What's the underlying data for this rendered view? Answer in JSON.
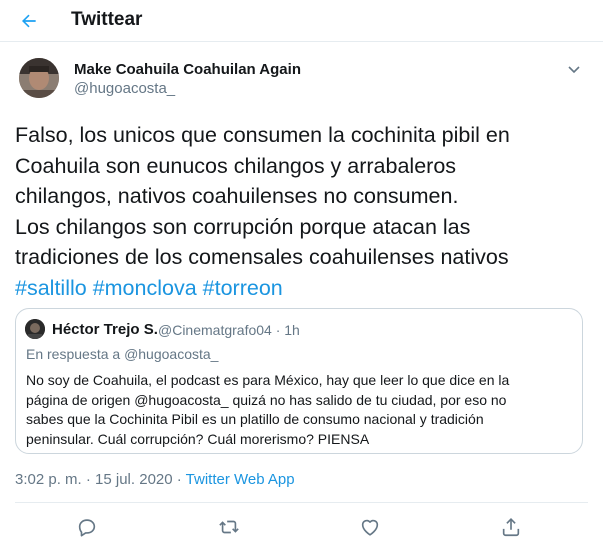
{
  "header": {
    "title": "Twittear",
    "back_icon": "arrow-left-icon"
  },
  "tweet": {
    "author_name": "Make Coahuila Coahuilan Again",
    "author_handle": "@hugoacosta_",
    "text_lines": [
      "Falso, los unicos que consumen la cochinita pibil en",
      "Coahuila son eunucos chilangos y arrabaleros",
      "chilangos, nativos coahuilenses no consumen.",
      "Los chilangos son corrupción porque atacan las",
      "tradiciones de los comensales coahuilenses nativos"
    ],
    "hashtags": [
      "#saltillo",
      "#monclova",
      "#torreon"
    ],
    "time": "3:02 p. m. · 15 jul. 2020 · ",
    "source": "Twitter Web App"
  },
  "quoted_tweet": {
    "author_name": "Héctor Trejo S.",
    "meta": "@Cinematgrafo04 · 1h",
    "reply_prefix": "En respuesta a ",
    "reply_handle": "@hugoacosta_",
    "text_lines": [
      "No soy de Coahuila, el podcast es para México, hay que leer lo que dice en la",
      "página de origen @hugoacosta_ quizá no has salido de tu ciudad, por eso no",
      "sabes que la Cochinita Pibil es un platillo de consumo nacional y tradición",
      "peninsular. Cuál corrupción? Cuál morerismo? PIENSA"
    ]
  },
  "actions": {
    "icons": [
      "reply-icon",
      "retweet-icon",
      "like-icon",
      "share-icon"
    ]
  },
  "colors": {
    "accent": "#1b95e0",
    "secondary_text": "#657786",
    "border": "#ccd6dd"
  }
}
